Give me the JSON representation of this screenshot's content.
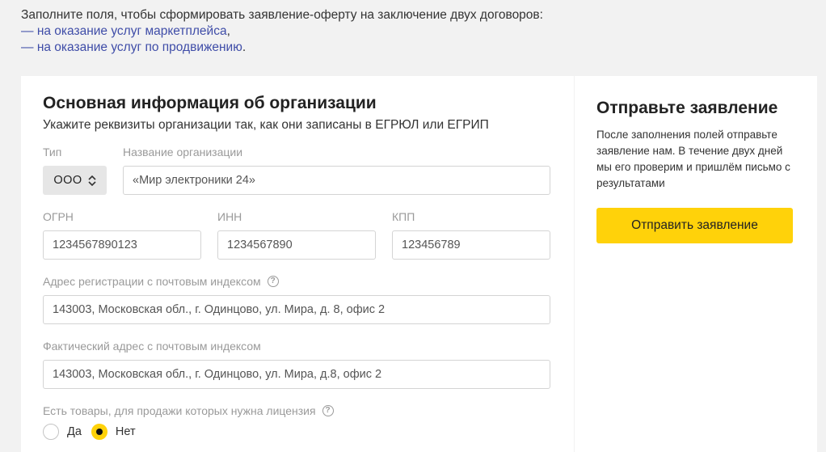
{
  "intro": {
    "text": "Заполните поля, чтобы сформировать заявление-оферту на заключение двух договоров:",
    "dash": "—",
    "link1": "на оказание услуг маркетплейса",
    "link1_suffix": ",",
    "link2": "на оказание услуг по продвижению",
    "link2_suffix": "."
  },
  "form": {
    "title": "Основная информация об организации",
    "subtitle": "Укажите реквизиты организации так, как они записаны в ЕГРЮЛ или ЕГРИП",
    "type_label": "Тип",
    "type_value": "ООО",
    "org_name_label": "Название организации",
    "org_name_placeholder": "«Мир электроники 24»",
    "ogrn_label": "ОГРН",
    "ogrn_placeholder": "1234567890123",
    "inn_label": "ИНН",
    "inn_placeholder": "1234567890",
    "kpp_label": "КПП",
    "kpp_placeholder": "123456789",
    "reg_address_label": "Адрес регистрации с почтовым индексом",
    "reg_address_placeholder": "143003, Московская обл., г. Одинцово, ул. Мира, д. 8, офис 2",
    "fact_address_label": "Фактический адрес с почтовым индексом",
    "fact_address_placeholder": "143003, Московская обл., г. Одинцово, ул. Мира, д.8, офис 2",
    "license_label": "Есть товары, для продажи которых нужна лицензия",
    "license_options": [
      "Да",
      "Нет"
    ],
    "license_selected": "Нет",
    "help_icon_glyph": "?"
  },
  "side": {
    "title": "Отправьте заявление",
    "text": "После заполнения полей отправьте заявление нам. В течение двух дней мы его проверим и пришлём письмо с результатами",
    "button": "Отправить заявление"
  },
  "colors": {
    "accent": "#ffd20a",
    "link": "#3f4da8",
    "background": "#f2f2f2"
  }
}
